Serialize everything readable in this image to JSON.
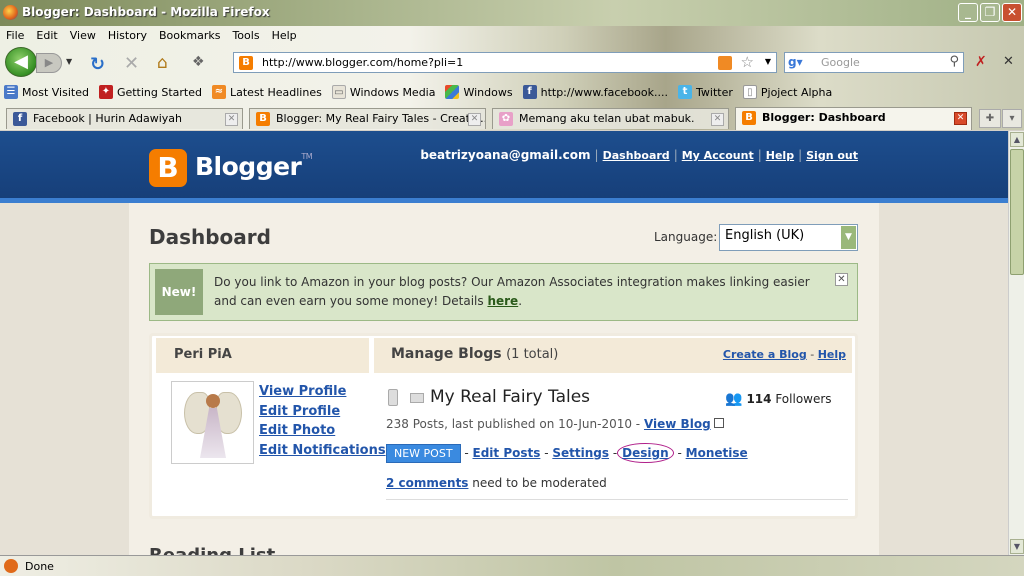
{
  "window": {
    "title": "Blogger: Dashboard - Mozilla Firefox"
  },
  "menu": [
    "File",
    "Edit",
    "View",
    "History",
    "Bookmarks",
    "Tools",
    "Help"
  ],
  "address": {
    "url": "http://www.blogger.com/home?pli=1"
  },
  "search": {
    "placeholder": "Google"
  },
  "bookmarks": [
    "Most Visited",
    "Getting Started",
    "Latest Headlines",
    "Windows Media",
    "Windows",
    "http://www.facebook....",
    "Twitter",
    "Pjoject Alpha"
  ],
  "tabs": [
    {
      "label": "Facebook | Hurin Adawiyah"
    },
    {
      "label": "Blogger: My Real Fairy Tales - Create ..."
    },
    {
      "label": "Memang aku telan ubat mabuk."
    },
    {
      "label": "Blogger: Dashboard"
    }
  ],
  "header": {
    "brand": "Blogger",
    "email": "beatrizyoana@gmail.com",
    "links": [
      "Dashboard",
      "My Account",
      "Help",
      "Sign out"
    ]
  },
  "dashboard": {
    "title": "Dashboard",
    "language_label": "Language:",
    "language_value": "English (UK)"
  },
  "notice": {
    "badge": "New!",
    "text": "Do you link to Amazon in your blog posts? Our Amazon Associates integration makes linking easier and can even earn you some money! Details",
    "link": "here"
  },
  "profile": {
    "name": "Peri PiA",
    "links": [
      "View Profile",
      "Edit Profile",
      "Edit Photo",
      "Edit Notifications"
    ]
  },
  "blogs": {
    "heading": "Manage Blogs",
    "count": "(1 total)",
    "create_link": "Create a Blog",
    "help_link": "Help",
    "blog_title": "My Real Fairy Tales",
    "followers_count": "114",
    "followers_label": "Followers",
    "meta": "238 Posts, last published on 10-Jun-2010 -",
    "view_blog": "View Blog",
    "new_post": "NEW POST",
    "actions": [
      "Edit Posts",
      "Settings",
      "Design",
      "Monetise"
    ],
    "comments_link": "2 comments",
    "comments_text": "need to be moderated"
  },
  "next_section": "Reading List",
  "status": {
    "text": "Done"
  },
  "colors": {
    "accent": "#f57d00",
    "header": "#1d4e8e",
    "link": "#2255aa"
  }
}
